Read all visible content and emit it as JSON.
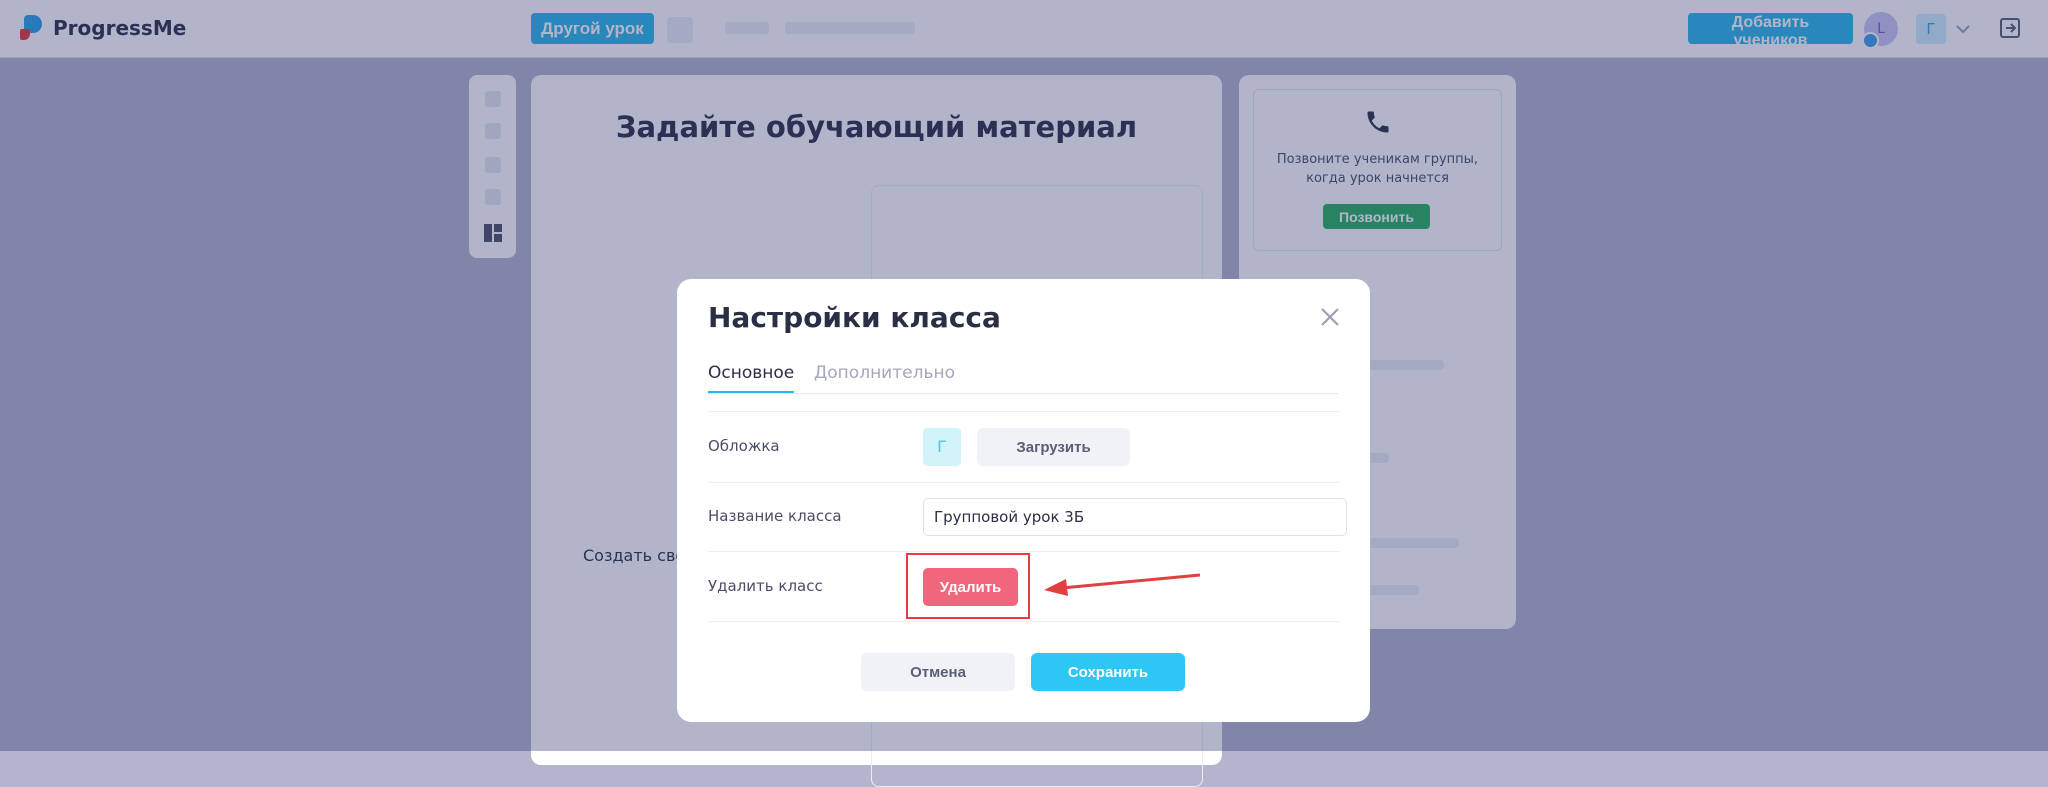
{
  "header": {
    "logo_text": "ProgressMe",
    "other_lesson_button": "Другой урок",
    "add_students_button": "Добавить учеников",
    "user_avatar_letter": "L",
    "class_avatar_letter": "Г"
  },
  "page": {
    "title": "Задайте обучающий материал",
    "create_own_text": "Создать свой",
    "call_panel": {
      "text": "Позвоните ученикам группы, когда урок начнется",
      "call_button": "Позвонить"
    }
  },
  "modal": {
    "title": "Настройки класса",
    "tabs": [
      {
        "label": "Основное",
        "active": true
      },
      {
        "label": "Дополнительно",
        "active": false
      }
    ],
    "cover": {
      "label": "Обложка",
      "thumb_letter": "Г",
      "upload_button": "Загрузить"
    },
    "class_name": {
      "label": "Название класса",
      "value": "Групповой урок 3Б"
    },
    "delete_class": {
      "label": "Удалить класс",
      "delete_button": "Удалить"
    },
    "cancel_button": "Отмена",
    "save_button": "Сохранить"
  },
  "colors": {
    "accent": "#27b8e8",
    "delete": "#f0667c",
    "call": "#25b15d",
    "annotation": "#e04040"
  },
  "icons": [
    "logo-icon",
    "chevron-down-icon",
    "logout-icon",
    "phone-icon",
    "close-icon",
    "layout-icon",
    "arrow-annotation-icon"
  ]
}
